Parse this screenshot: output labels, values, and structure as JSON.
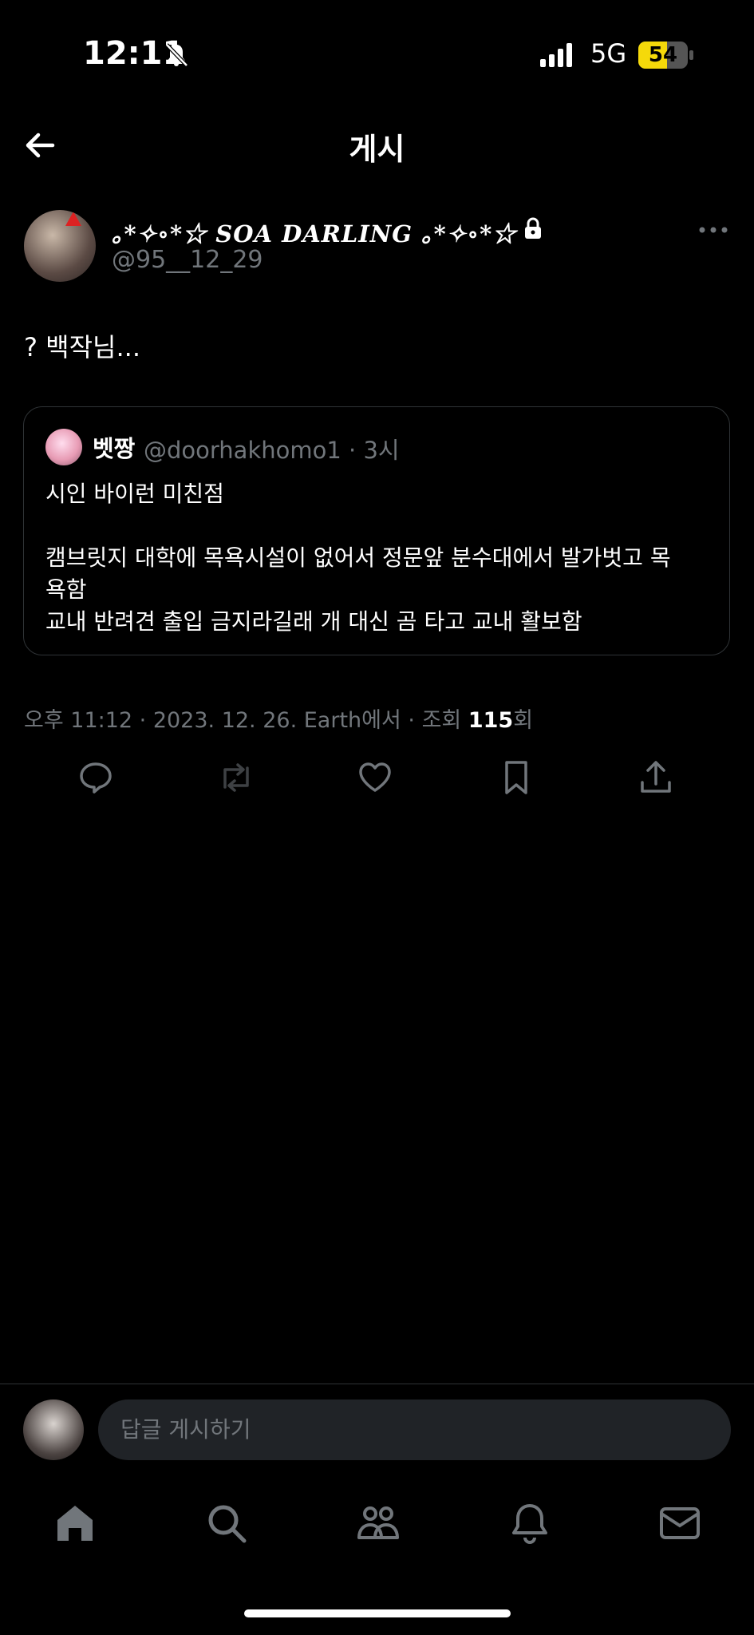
{
  "status_bar": {
    "time": "12:11",
    "network": "5G",
    "battery": "54",
    "icons": [
      "bell-slash-icon",
      "signal-icon",
      "battery-icon"
    ]
  },
  "header": {
    "title": "게시",
    "back_icon": "arrow-left-icon"
  },
  "tweet": {
    "display_name": "｡*✧∘*☆ 𝑺𝑶𝑨 𝑫𝑨𝑹𝑳𝑰𝑵𝑮 ｡*✧∘*☆",
    "handle": "@95__12_29",
    "text": "? 백작님...",
    "quote": {
      "name": "벳짱",
      "handle": "@doorhakhomo1",
      "time": "· 3시",
      "lines": [
        "시인 바이런 미친점",
        "캠브릿지 대학에 목욕시설이 없어서 정문앞 분수대에서 발가벗고 목",
        "욕함",
        "교내 반려견 출입 금지라길래 개 대신 곰 타고 교내 활보함"
      ]
    },
    "meta_prefix": "오후 11:12 · 2023. 12. 26. Earth에서 · 조회 ",
    "views": "115",
    "views_suffix": "회"
  },
  "reply": {
    "placeholder": "답글 게시하기"
  },
  "actions": [
    "reply-icon",
    "retweet-icon",
    "like-icon",
    "bookmark-icon",
    "share-icon"
  ],
  "nav": [
    "home-icon",
    "search-icon",
    "communities-icon",
    "notifications-icon",
    "messages-icon"
  ],
  "colors": {
    "background": "#000000",
    "secondary_text": "#71767b",
    "border": "#2f3336",
    "battery": "#f5d90a"
  }
}
